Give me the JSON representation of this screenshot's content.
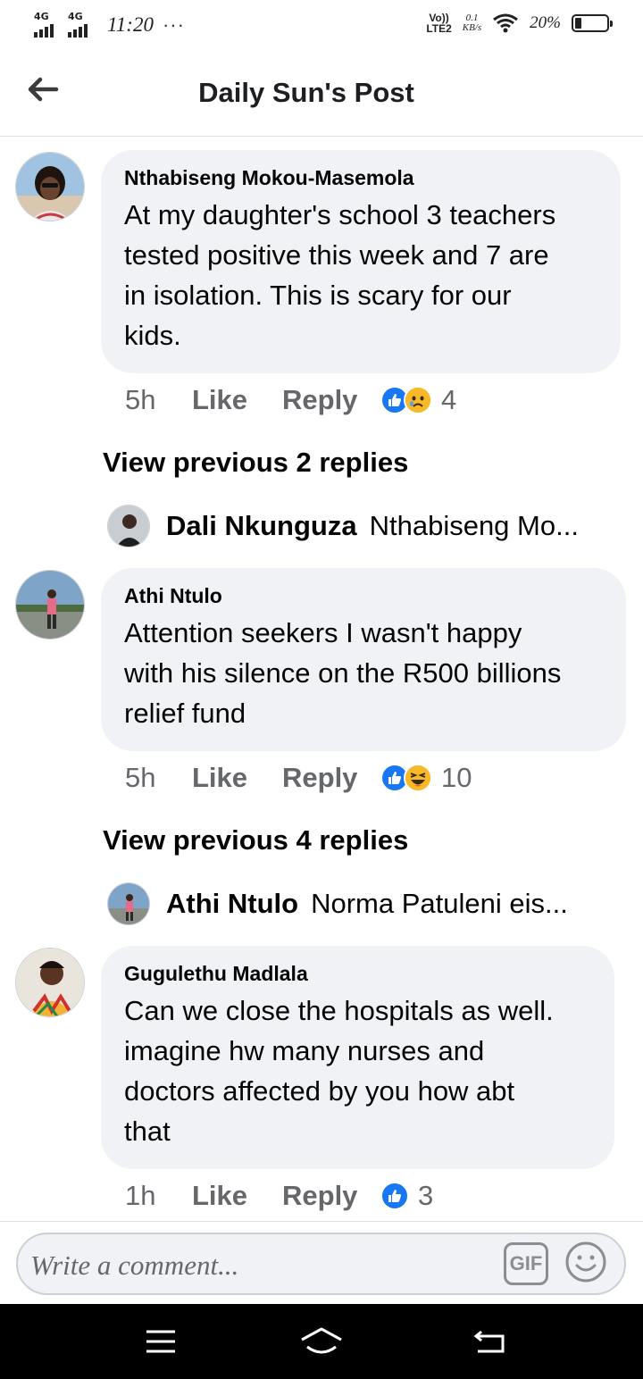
{
  "status_bar": {
    "network_1": "4G",
    "network_2": "4G",
    "time": "11:20",
    "more": "···",
    "volte_top": "Vo))",
    "volte_bottom": "LTE2",
    "speed_value": "0.1",
    "speed_unit": "KB/s",
    "battery_percent": "20%",
    "battery_level": 0.2
  },
  "header": {
    "back_icon": "arrow-left-icon",
    "title": "Daily Sun's Post"
  },
  "comments": [
    {
      "author": "Nthabiseng Mokou-Masemola",
      "lines": [
        "At my daughter's school 3 teachers",
        "tested positive this week and 7 are",
        "in isolation. This is scary for our",
        "kids."
      ],
      "time": "5h",
      "like_label": "Like",
      "reply_label": "Reply",
      "reactions": [
        "like",
        "sad"
      ],
      "reaction_count": "4",
      "view_previous": "View previous 2 replies",
      "reply_preview": {
        "name": "Dali Nkunguza",
        "snippet": "Nthabiseng Mo..."
      }
    },
    {
      "author": "Athi Ntulo",
      "lines": [
        "Attention seekers I wasn't happy",
        "with his silence on the R500 billions",
        "relief fund"
      ],
      "time": "5h",
      "like_label": "Like",
      "reply_label": "Reply",
      "reactions": [
        "like",
        "haha"
      ],
      "reaction_count": "10",
      "view_previous": "View previous 4 replies",
      "reply_preview": {
        "name": "Athi Ntulo",
        "snippet": "Norma Patuleni eis..."
      }
    },
    {
      "author": "Gugulethu Madlala",
      "lines": [
        "Can we close the hospitals as well.",
        "imagine hw many nurses and",
        "doctors affected by you how abt",
        "that"
      ],
      "time": "1h",
      "like_label": "Like",
      "reply_label": "Reply",
      "reactions": [
        "like"
      ],
      "reaction_count": "3"
    }
  ],
  "composer": {
    "placeholder": "Write a comment...",
    "gif_label": "GIF",
    "emoji_icon": "smiley-icon"
  },
  "colors": {
    "fb_blue": "#1877f2",
    "bubble_bg": "#f0f2f5",
    "muted_text": "#65676b",
    "reaction_yellow": "#f7b928"
  }
}
